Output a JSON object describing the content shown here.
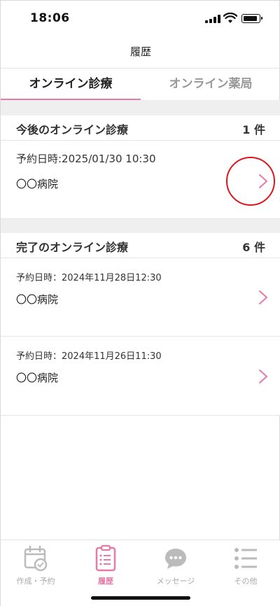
{
  "status_bar": {
    "time": "18:06"
  },
  "header": {
    "title": "履歴"
  },
  "tabs": [
    {
      "label": "オンライン診療",
      "active": true
    },
    {
      "label": "オンライン薬局",
      "active": false
    }
  ],
  "upcoming": {
    "title": "今後のオンライン診療",
    "count": "1 件",
    "items": [
      {
        "date": "予約日時:2025/01/30  10:30",
        "hospital": "〇〇病院"
      }
    ]
  },
  "completed": {
    "title": "完了のオンライン診療",
    "count": "6 件",
    "items": [
      {
        "date": "予約日時：2024年11月28日12:30",
        "hospital": "〇〇病院"
      },
      {
        "date": "予約日時：2024年11月26日11:30",
        "hospital": "〇〇病院"
      }
    ]
  },
  "bottom_nav": [
    {
      "label": "作成・予約",
      "icon": "calendar-check-icon",
      "active": false
    },
    {
      "label": "履歴",
      "icon": "clipboard-list-icon",
      "active": true
    },
    {
      "label": "メッセージ",
      "icon": "chat-bubble-icon",
      "active": false
    },
    {
      "label": "その他",
      "icon": "menu-list-icon",
      "active": false
    }
  ],
  "colors": {
    "accent": "#e87aa8",
    "highlight": "#e0141a",
    "divider": "#efefef"
  }
}
